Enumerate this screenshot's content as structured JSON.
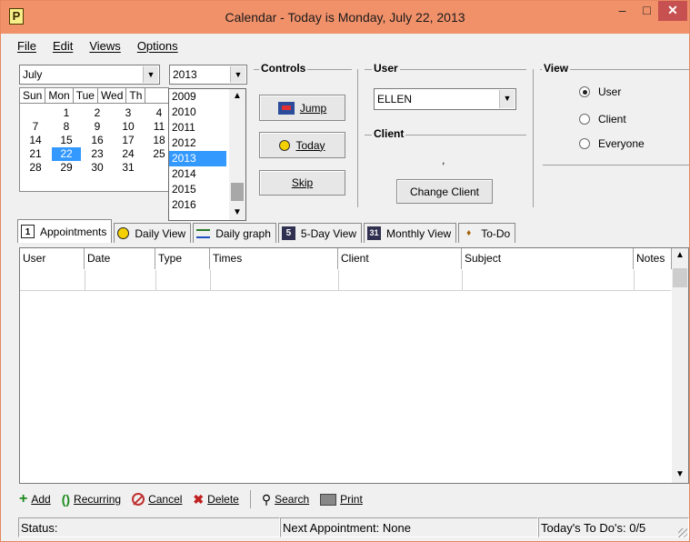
{
  "window": {
    "title": "Calendar - Today is Monday, July 22, 2013",
    "app_icon_letter": "P",
    "controls": {
      "minimize": "–",
      "maximize": "□",
      "close": "✕"
    }
  },
  "menu": [
    {
      "label": "File"
    },
    {
      "label": "Edit"
    },
    {
      "label": "Views"
    },
    {
      "label": "Options"
    }
  ],
  "month_select": {
    "value": "July"
  },
  "year_select": {
    "value": "2013"
  },
  "calendar": {
    "weekdays": [
      "Sun",
      "Mon",
      "Tue",
      "Wed",
      "Th"
    ],
    "weeks": [
      [
        "",
        "1",
        "2",
        "3",
        "4"
      ],
      [
        "7",
        "8",
        "9",
        "10",
        "11"
      ],
      [
        "14",
        "15",
        "16",
        "17",
        "18"
      ],
      [
        "21",
        "22",
        "23",
        "24",
        "25"
      ],
      [
        "28",
        "29",
        "30",
        "31",
        ""
      ]
    ],
    "selected_day": "22"
  },
  "year_list": {
    "items": [
      "2009",
      "2010",
      "2011",
      "2012",
      "2013",
      "2014",
      "2015",
      "2016"
    ],
    "selected": "2013"
  },
  "controls": {
    "label": "Controls",
    "jump": "Jump",
    "today": "Today",
    "skip": "Skip"
  },
  "user_group": {
    "label": "User",
    "selected_user": "ELLEN"
  },
  "client_group": {
    "label": "Client",
    "value": ",",
    "change_button": "Change Client"
  },
  "view_group": {
    "label": "View",
    "options": [
      {
        "label": "User",
        "checked": true
      },
      {
        "label": "Client",
        "checked": false
      },
      {
        "label": "Everyone",
        "checked": false
      }
    ]
  },
  "tabs": [
    {
      "label": "Appointments",
      "icon": "calendar-1-icon",
      "glyph": "1"
    },
    {
      "label": "Daily View",
      "icon": "sun-icon",
      "glyph": ""
    },
    {
      "label": "Daily graph",
      "icon": "graph-icon",
      "glyph": ""
    },
    {
      "label": "5-Day View",
      "icon": "calendar-5-icon",
      "glyph": "5"
    },
    {
      "label": "Monthly View",
      "icon": "calendar-31-icon",
      "glyph": "31"
    },
    {
      "label": "To-Do",
      "icon": "pin-icon",
      "glyph": "♦"
    }
  ],
  "table": {
    "columns": [
      "User",
      "Date",
      "Type",
      "Times",
      "Client",
      "Subject",
      "Notes"
    ],
    "rows": []
  },
  "toolbar": {
    "add": "Add",
    "recurring": "Recurring",
    "cancel": "Cancel",
    "delete": "Delete",
    "search": "Search",
    "print": "Print"
  },
  "status": {
    "status_label": "Status:",
    "next_appointment": "Next Appointment: None",
    "todos": "Today's To Do's: 0/5"
  },
  "colors": {
    "titlebar": "#f1916a",
    "selection": "#3399ff",
    "close_button": "#c75050"
  }
}
